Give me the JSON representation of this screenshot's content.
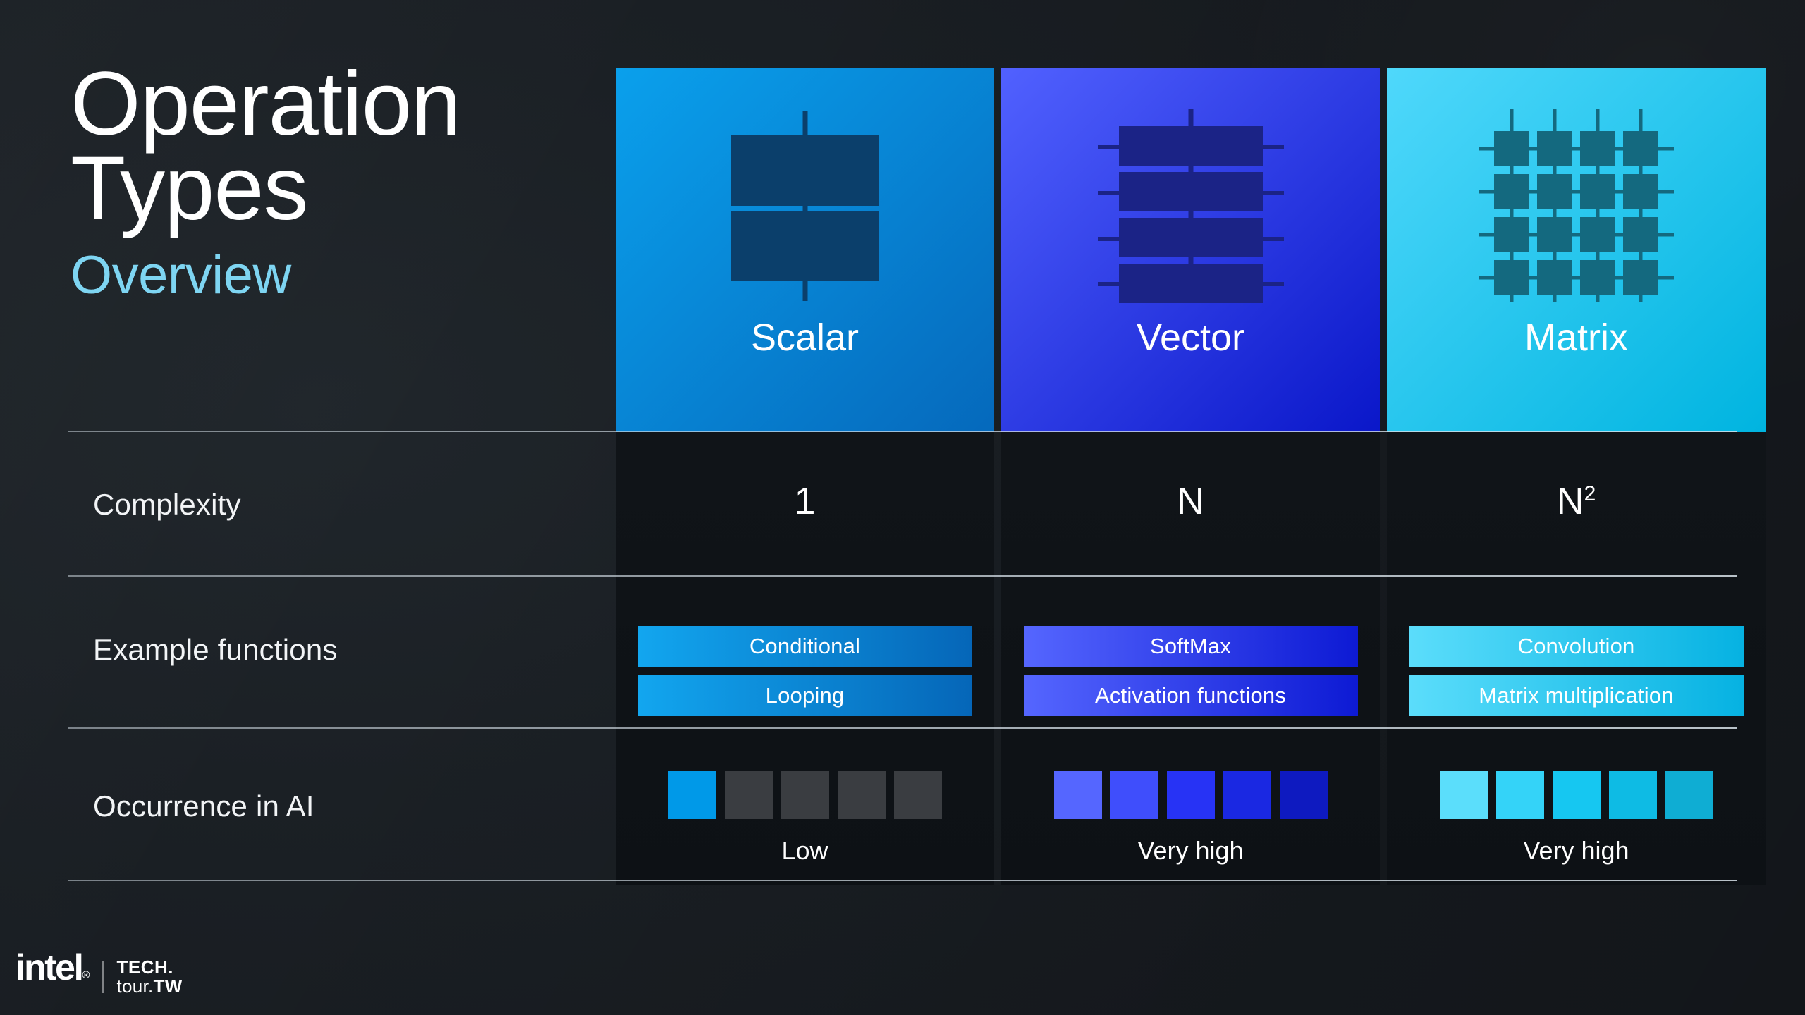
{
  "slide": {
    "title_line1": "Operation",
    "title_line2": "Types",
    "subtitle": "Overview",
    "accent_color": "#7ed5f2",
    "background_color": "#1b2025"
  },
  "columns": [
    {
      "key": "scalar",
      "label": "Scalar",
      "icon": "scalar-icon",
      "gradient_from": "#0aa0ec",
      "gradient_to": "#0569bc",
      "icon_color": "#0b3f6b",
      "complexity": "1",
      "complexity_sup": "",
      "functions": [
        "Conditional",
        "Looping"
      ],
      "pill_from": "#12a6ef",
      "pill_to": "#0566b8",
      "occurrence_label": "Low",
      "occurrence_filled": 1,
      "occurrence_total": 5,
      "occurrence_colors": [
        "#0099e8",
        "#3a3d41",
        "#3a3d41",
        "#3a3d41",
        "#3a3d41"
      ]
    },
    {
      "key": "vector",
      "label": "Vector",
      "icon": "vector-icon",
      "gradient_from": "#5161ff",
      "gradient_to": "#0a17c9",
      "icon_color": "#1b2386",
      "complexity": "N",
      "complexity_sup": "",
      "functions": [
        "SoftMax",
        "Activation functions"
      ],
      "pill_from": "#5566ff",
      "pill_to": "#0d1ad4",
      "occurrence_label": "Very high",
      "occurrence_filled": 5,
      "occurrence_total": 5,
      "occurrence_colors": [
        "#5566ff",
        "#3f4efc",
        "#2733f5",
        "#1a28e2",
        "#0e1ac0"
      ]
    },
    {
      "key": "matrix",
      "label": "Matrix",
      "icon": "matrix-icon",
      "gradient_from": "#4fd8fb",
      "gradient_to": "#00b4e0",
      "icon_color": "#14697f",
      "complexity": "N",
      "complexity_sup": "2",
      "functions": [
        "Convolution",
        "Matrix multiplication"
      ],
      "pill_from": "#5bddfb",
      "pill_to": "#06b2e2",
      "occurrence_label": "Very high",
      "occurrence_filled": 5,
      "occurrence_total": 5,
      "occurrence_colors": [
        "#5bdefb",
        "#34d3f8",
        "#16c7f1",
        "#0ebbe4",
        "#0fadd3"
      ]
    }
  ],
  "rows": [
    {
      "key": "complexity",
      "label": "Complexity"
    },
    {
      "key": "example_functions",
      "label": "Example functions"
    },
    {
      "key": "occurrence",
      "label": "Occurrence in AI"
    }
  ],
  "logo": {
    "intel": "intel",
    "intel_reg": "®",
    "tech_line1": "TECH",
    "tech_dot": ".",
    "tech_line2_a": "tour.",
    "tech_line2_b": "TW"
  }
}
